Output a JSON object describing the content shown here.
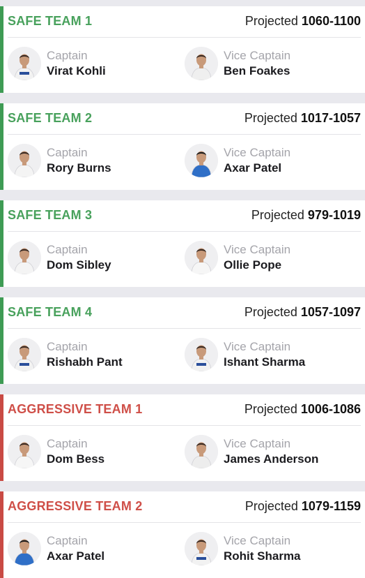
{
  "teams": [
    {
      "title": "SAFE TEAM 1",
      "kind": "safe",
      "projected_label": "Projected",
      "projected_range": "1060-1100",
      "captain": {
        "role": "Captain",
        "name": "Virat Kohli",
        "kit": "white-blue"
      },
      "vice_captain": {
        "role": "Vice Captain",
        "name": "Ben Foakes",
        "kit": "white-beard"
      }
    },
    {
      "title": "SAFE TEAM 2",
      "kind": "safe",
      "projected_label": "Projected",
      "projected_range": "1017-1057",
      "captain": {
        "role": "Captain",
        "name": "Rory Burns",
        "kit": "white"
      },
      "vice_captain": {
        "role": "Vice Captain",
        "name": "Axar Patel",
        "kit": "blue"
      }
    },
    {
      "title": "SAFE TEAM 3",
      "kind": "safe",
      "projected_label": "Projected",
      "projected_range": "979-1019",
      "captain": {
        "role": "Captain",
        "name": "Dom Sibley",
        "kit": "white"
      },
      "vice_captain": {
        "role": "Vice Captain",
        "name": "Ollie Pope",
        "kit": "white-light"
      }
    },
    {
      "title": "SAFE TEAM 4",
      "kind": "safe",
      "projected_label": "Projected",
      "projected_range": "1057-1097",
      "captain": {
        "role": "Captain",
        "name": "Rishabh Pant",
        "kit": "white-blue"
      },
      "vice_captain": {
        "role": "Vice Captain",
        "name": "Ishant Sharma",
        "kit": "white-blue"
      }
    },
    {
      "title": "AGGRESSIVE TEAM 1",
      "kind": "aggressive",
      "projected_label": "Projected",
      "projected_range": "1006-1086",
      "captain": {
        "role": "Captain",
        "name": "Dom Bess",
        "kit": "white-light"
      },
      "vice_captain": {
        "role": "Vice Captain",
        "name": "James Anderson",
        "kit": "white-dark"
      }
    },
    {
      "title": "AGGRESSIVE TEAM 2",
      "kind": "aggressive",
      "projected_label": "Projected",
      "projected_range": "1079-1159",
      "captain": {
        "role": "Captain",
        "name": "Axar Patel",
        "kit": "blue"
      },
      "vice_captain": {
        "role": "Vice Captain",
        "name": "Rohit Sharma",
        "kit": "white-blue"
      }
    }
  ],
  "colors": {
    "safe": "#48a15c",
    "aggressive": "#cf4f48",
    "kits": {
      "white": "#f4f4f4",
      "white-blue": "#f2f2f2",
      "white-beard": "#efefef",
      "white-light": "#f6f6f6",
      "white-dark": "#ededed",
      "blue": "#2f6fc7"
    }
  },
  "icons": {
    "avatar": "player-photo"
  }
}
